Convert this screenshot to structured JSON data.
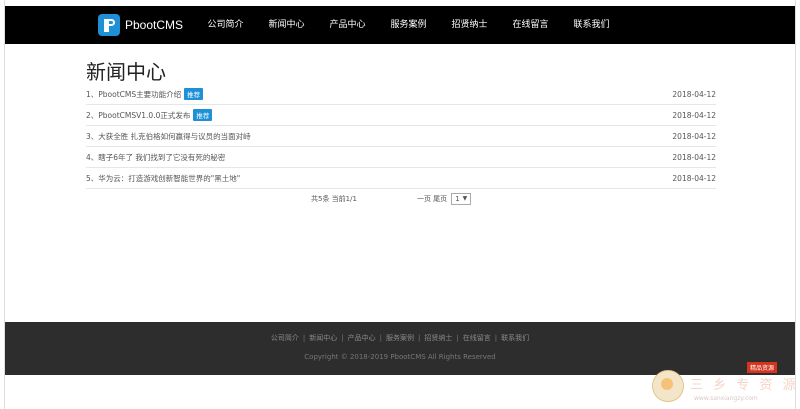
{
  "header": {
    "logo_text": "PbootCMS",
    "nav": [
      "公司简介",
      "新闻中心",
      "产品中心",
      "服务案例",
      "招贤纳士",
      "在线留言",
      "联系我们"
    ]
  },
  "main": {
    "title": "新闻中心",
    "news": [
      {
        "title": "1、PbootCMS主要功能介绍",
        "badge": "推荐",
        "date": "2018-04-12"
      },
      {
        "title": "2、PbootCMSV1.0.0正式发布",
        "badge": "推荐",
        "date": "2018-04-12"
      },
      {
        "title": "3、大获全胜 扎克伯格如何赢得与议员的当面对峙",
        "badge": "",
        "date": "2018-04-12"
      },
      {
        "title": "4、瞎子6年了 我们找到了它没有死的秘密",
        "badge": "",
        "date": "2018-04-12"
      },
      {
        "title": "5、华为云：打造游戏创新智能世界的\"黑土地\"",
        "badge": "",
        "date": "2018-04-12"
      }
    ],
    "pagination": {
      "summary_left": "共5条 当前1/1",
      "summary_right": "一页 尾页",
      "page_select": "1"
    }
  },
  "footer": {
    "links": [
      "公司简介",
      "新闻中心",
      "产品中心",
      "服务案例",
      "招贤纳士",
      "在线留言",
      "联系我们"
    ],
    "separator": "|",
    "copyright": "Copyright © 2018-2019 PbootCMS All Rights Reserved"
  },
  "watermark": {
    "badge": "精品资源",
    "text": "三 乡 专 资 源 网",
    "url": "www.sanxiangzy.com"
  }
}
